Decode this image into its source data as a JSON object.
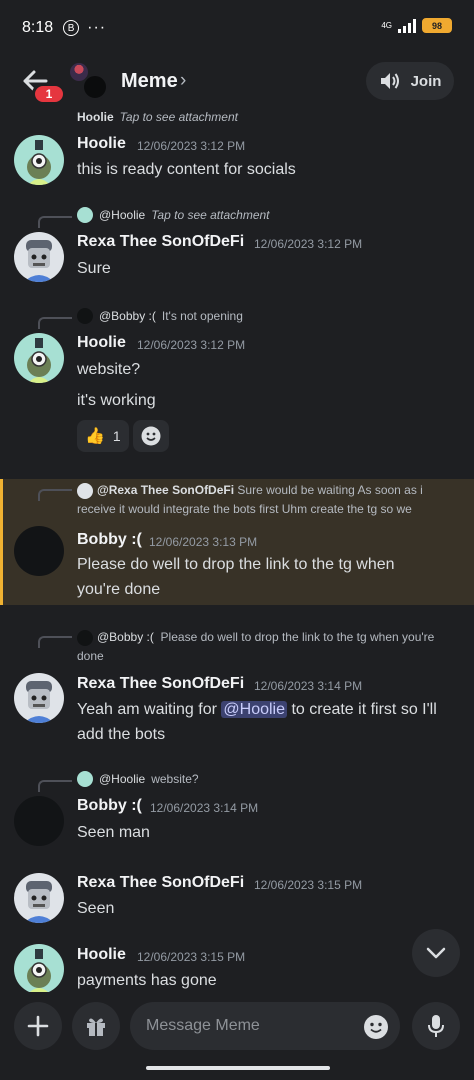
{
  "status_bar": {
    "time": "8:18",
    "b_icon": "B",
    "dots": "···",
    "network": "4G",
    "battery": "98"
  },
  "header": {
    "unread_count": "1",
    "channel": "Meme",
    "chevron": "›",
    "join_label": "Join"
  },
  "messages": [
    {
      "reply": {
        "name": "Hoolie",
        "text": "Tap to see attachment"
      },
      "user": "Hoolie",
      "time": "12/06/2023 3:12 PM",
      "lines": [
        "this is ready content for socials"
      ]
    },
    {
      "reply": {
        "name": "@Hoolie",
        "text": "Tap to see attachment"
      },
      "user": "Rexa Thee SonOfDeFi",
      "time": "12/06/2023 3:12 PM",
      "lines": [
        "Sure"
      ]
    },
    {
      "reply": {
        "name": "@Bobby :(",
        "text": "It's not opening"
      },
      "user": "Hoolie",
      "time": "12/06/2023 3:12 PM",
      "lines": [
        "website?",
        "it's working"
      ],
      "reaction": {
        "emoji": "👍",
        "count": "1"
      }
    },
    {
      "reply": {
        "name": "@Rexa Thee SonOfDeFi",
        "text": "Sure would be waiting As soon as i receive it would integrate the bots first  Uhm create the tg so we"
      },
      "user": "Bobby :(",
      "time": "12/06/2023 3:13 PM",
      "lines": [
        "Please do well to drop the link to the tg when you're done"
      ]
    },
    {
      "reply": {
        "name": "@Bobby :(",
        "text": "Please do well to drop the link to the tg when you're done"
      },
      "user": "Rexa Thee SonOfDeFi",
      "time": "12/06/2023 3:14 PM",
      "text_before": "Yeah am waiting for ",
      "mention": "@Hoolie",
      "text_after": " to create it first so I'll add the bots"
    },
    {
      "reply": {
        "name": "@Hoolie",
        "text": "website?"
      },
      "user": "Bobby :(",
      "time": "12/06/2023 3:14 PM",
      "lines": [
        "Seen man"
      ]
    },
    {
      "user": "Rexa Thee SonOfDeFi",
      "time": "12/06/2023 3:15 PM",
      "lines": [
        "Seen"
      ]
    },
    {
      "user": "Hoolie",
      "time": "12/06/2023 3:15 PM",
      "lines": [
        "payments has gone"
      ]
    }
  ],
  "composer": {
    "placeholder": "Message Meme"
  }
}
